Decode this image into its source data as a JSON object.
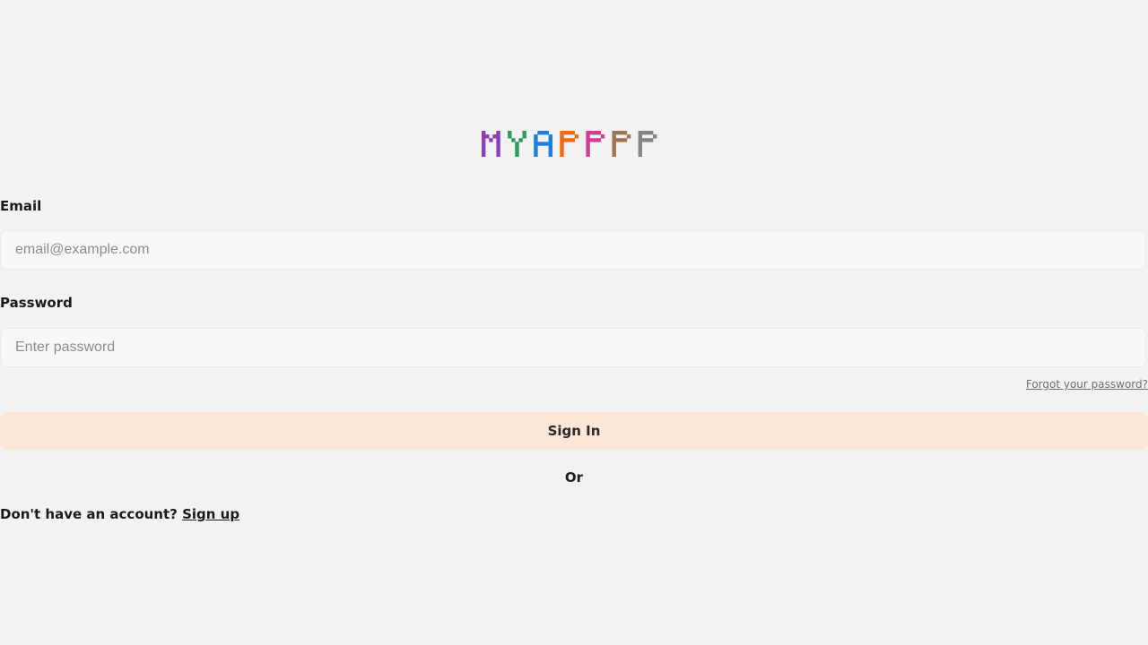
{
  "logo": {
    "text": "MYAPPPP",
    "letter_colors": [
      "#8a3fbf",
      "#2e9a5e",
      "#1e7fe0",
      "#f06a13",
      "#d63a96",
      "#a07650",
      "#858585"
    ]
  },
  "form": {
    "email_label": "Email",
    "email_placeholder": "email@example.com",
    "email_value": "",
    "password_label": "Password",
    "password_placeholder": "Enter password",
    "password_value": "",
    "forgot_label": "Forgot your password?",
    "submit_label": "Sign In",
    "button_color": "#fde6d7"
  },
  "divider": {
    "or_label": "Or"
  },
  "signup": {
    "prompt": "Don't have an account?",
    "link_label": "Sign up"
  }
}
